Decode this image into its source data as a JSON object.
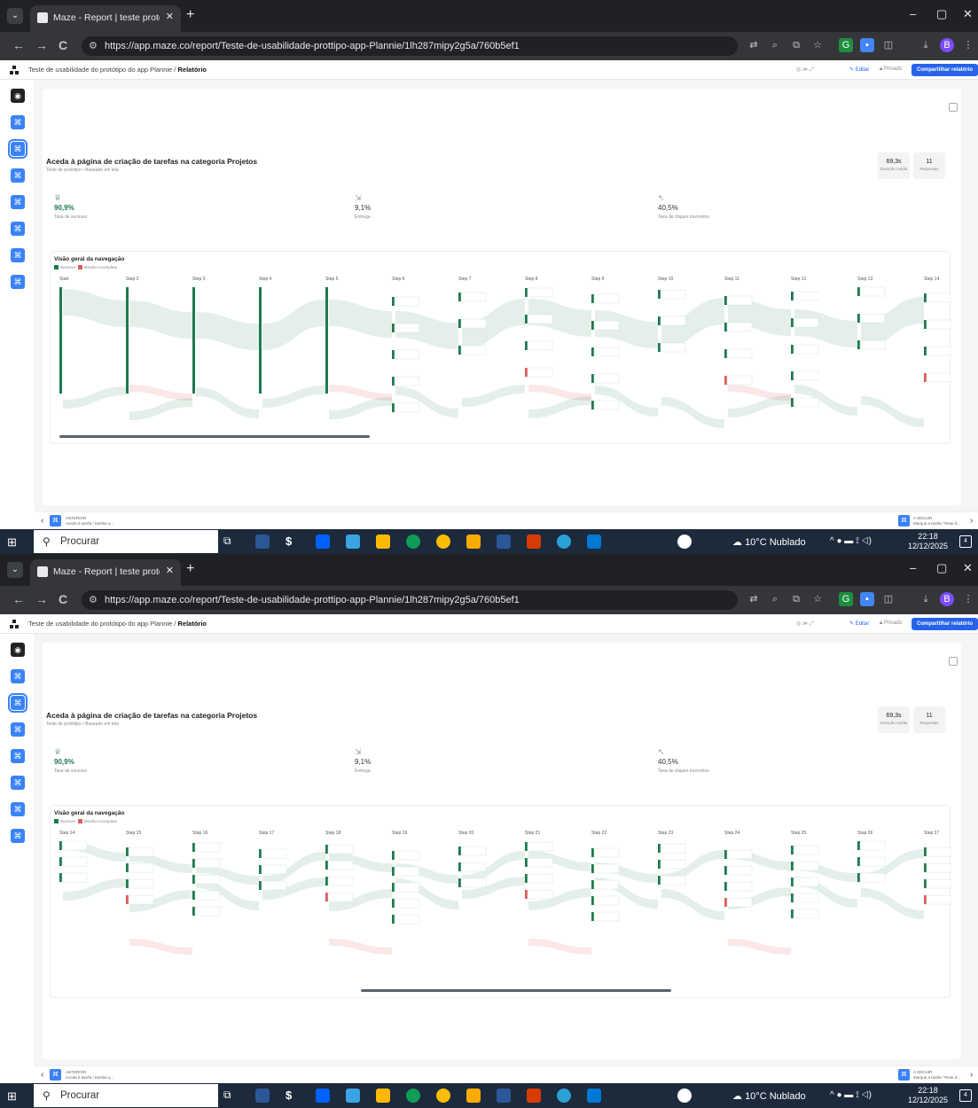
{
  "browser": {
    "tab_title": "Maze - Report | teste prototipo",
    "tab_close": "✕",
    "new_tab": "+",
    "url": "https://app.maze.co/report/Teste-de-usabilidade-prottipo-app-Plannie/1lh287mipy2g5a/760b5ef1",
    "minimize": "–",
    "maximize": "▢",
    "close": "✕",
    "back": "←",
    "forward": "→",
    "reload": "C"
  },
  "header": {
    "project": "Teste de usabilidade do protótipo do app Plannie",
    "separator": " / ",
    "page": "Relatório",
    "edit": "Editar",
    "privacy": "Privado",
    "share": "Compartilhar relatório"
  },
  "task": {
    "title": "Aceda à página de criação de tarefas na categoria Projetos",
    "subtitle": "Teste de protótipo • Baseado em tela",
    "avg_duration_value": "69,3s",
    "avg_duration_label": "Duração média",
    "responses_value": "11",
    "responses_label": "Respostas"
  },
  "kpis": {
    "success_value": "90,9%",
    "success_label": "Taxa de sucesso",
    "delivery_value": "9,1%",
    "delivery_label": "Entrega",
    "misclick_value": "40,5%",
    "misclick_label": "Taxa de cliques incorretos"
  },
  "navigation": {
    "title": "Visão geral da navegação",
    "legend_success": "Sucesso",
    "legend_fail": "Missão incompleta",
    "view1_steps": [
      "Start",
      "Step 2",
      "Step 3",
      "Step 4",
      "Step 5",
      "Step 6",
      "Step 7",
      "Step 8",
      "Step 9",
      "Step 10",
      "Step 11",
      "Step 12",
      "Step 13",
      "Step 14"
    ],
    "view2_steps": [
      "Step 14",
      "Step 15",
      "Step 16",
      "Step 17",
      "Step 18",
      "Step 19",
      "Step 20",
      "Step 21",
      "Step 22",
      "Step 23",
      "Step 24",
      "Step 25",
      "Step 26",
      "Step 27"
    ]
  },
  "footer": {
    "prev_label": "ANTERIOR",
    "prev_task": "Aceda à tarefa / tarefas q...",
    "next_label": "A SEGUIR",
    "next_task": "Marque a tarefa \"Teste d..."
  },
  "taskbar": {
    "search": "Procurar",
    "weather": "10°C Nublado",
    "time": "22:18",
    "date": "12/12/2025",
    "notif": "4"
  },
  "colors": {
    "success": "#1f7a4d",
    "fail": "#e05c5c",
    "accent": "#2563eb"
  }
}
